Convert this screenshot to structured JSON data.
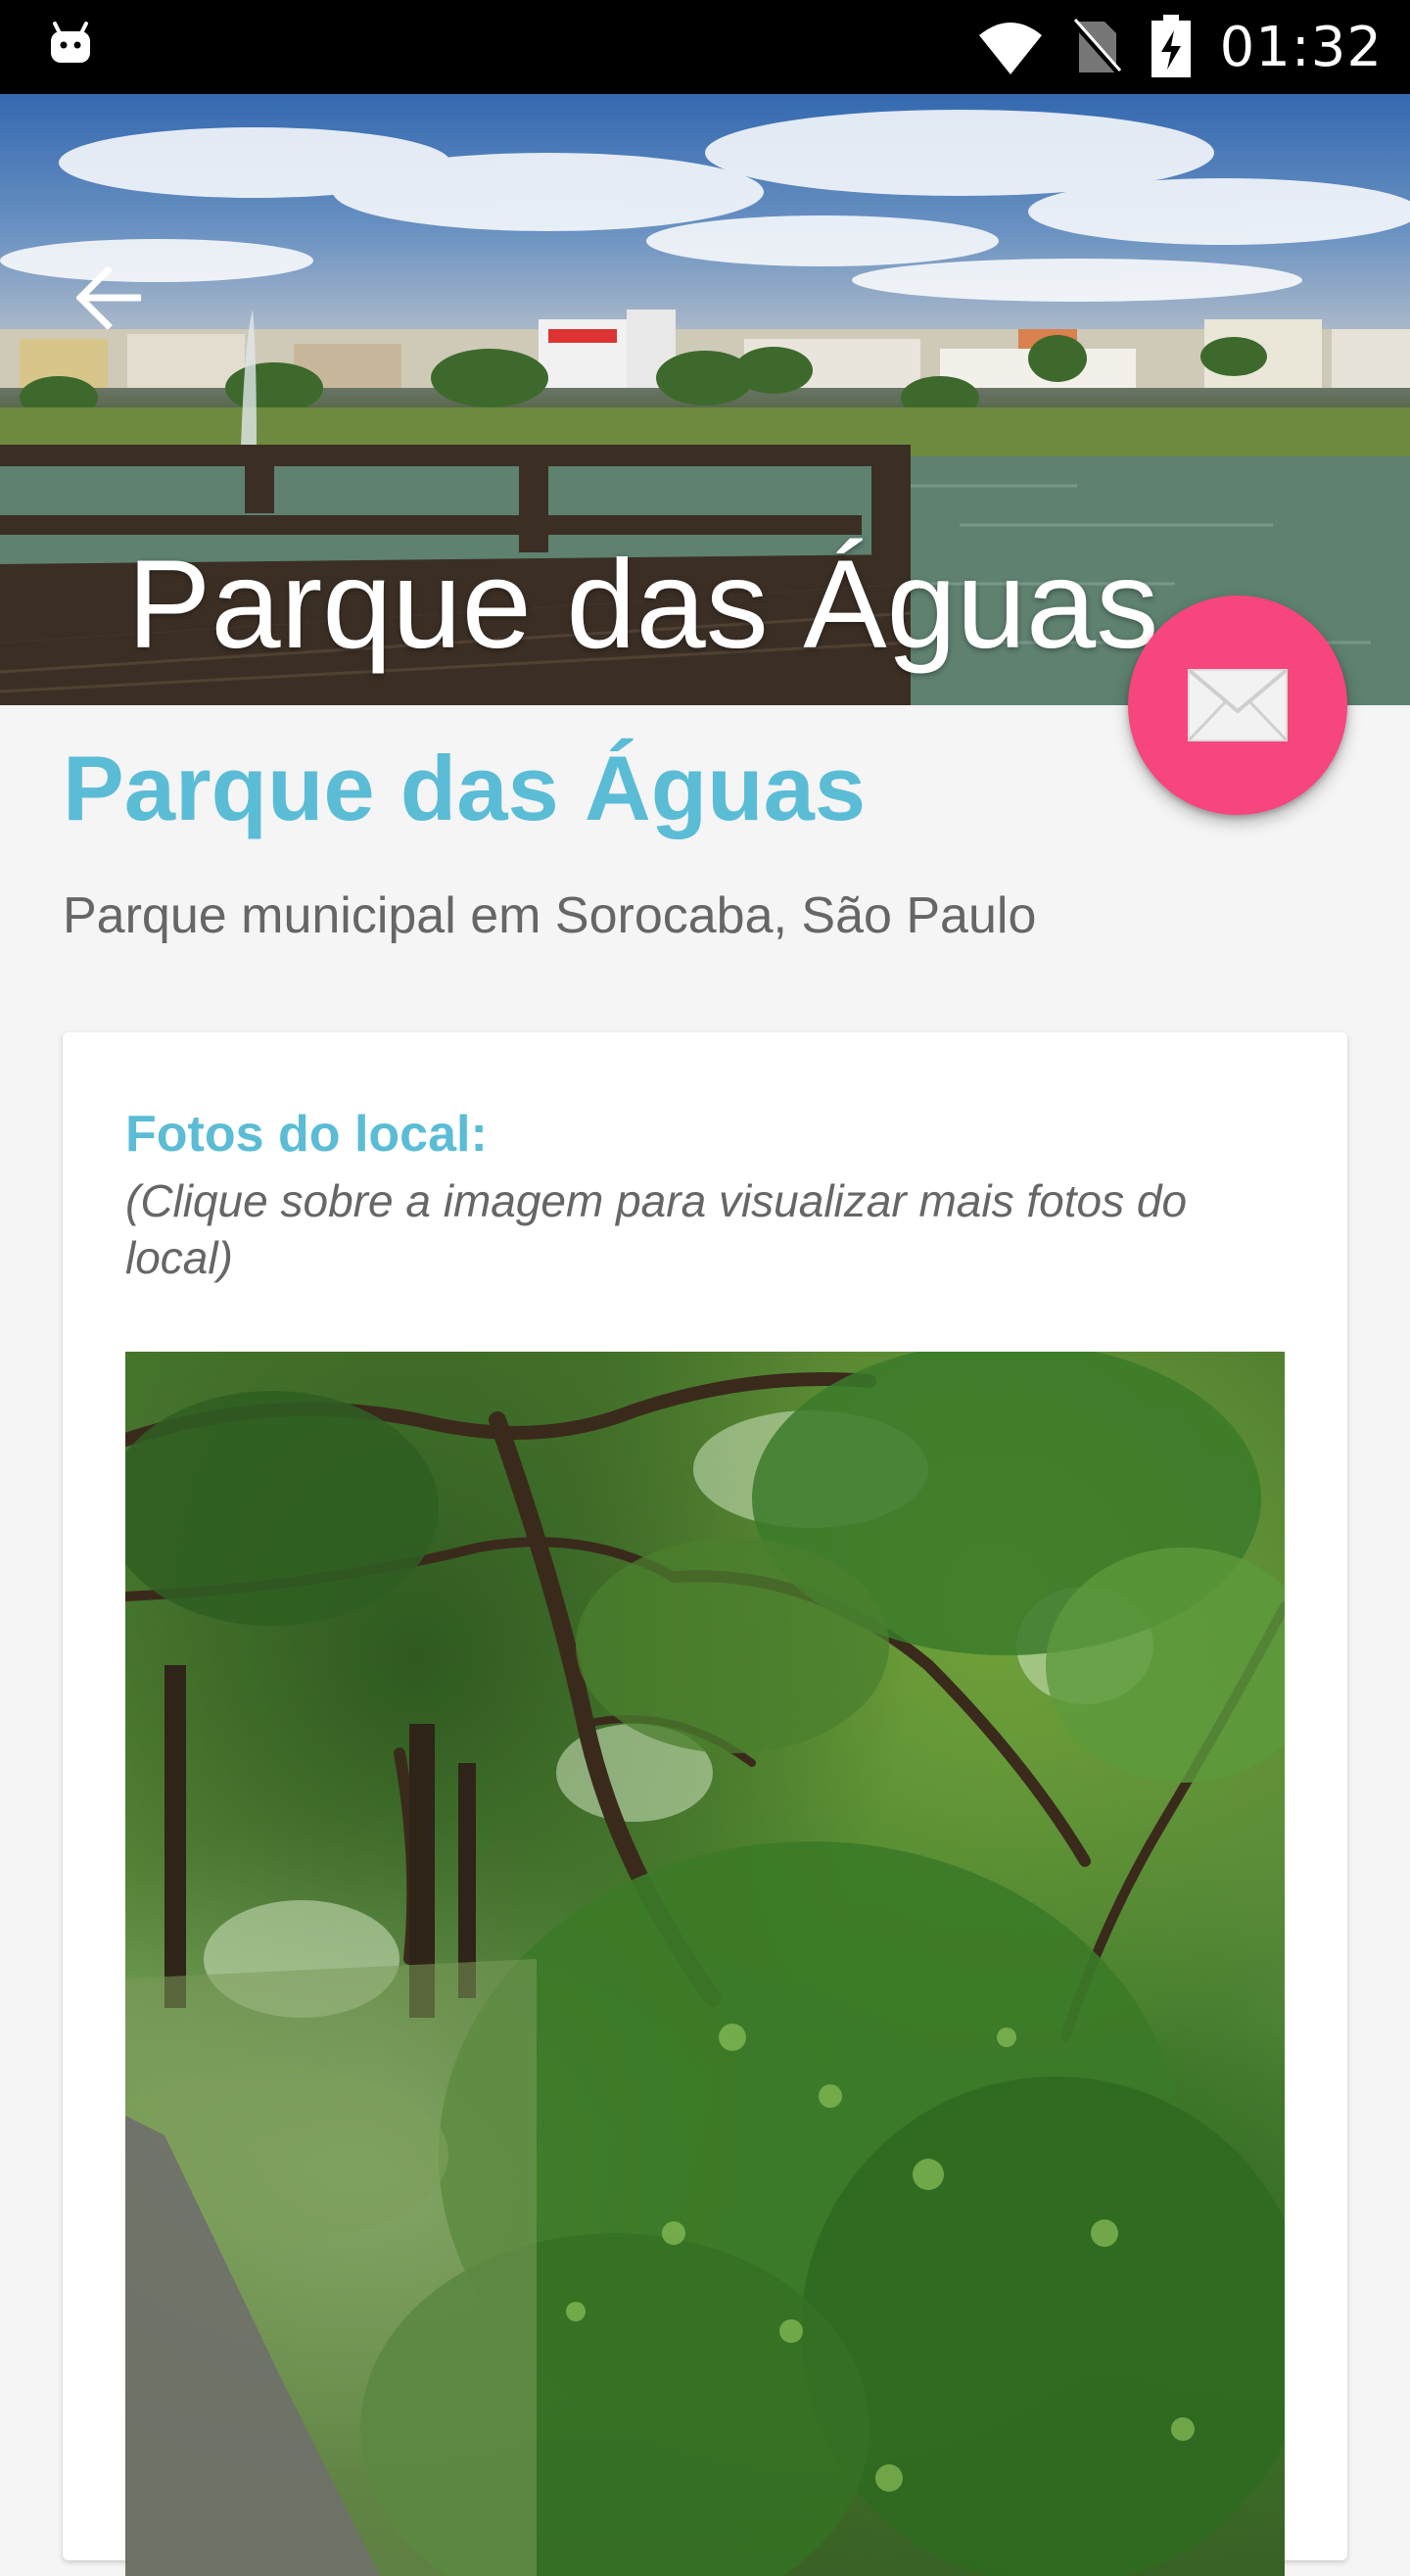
{
  "status_bar": {
    "time": "01:32",
    "icons": [
      "android-icon",
      "wifi-icon",
      "no-sim-icon",
      "battery-charging-icon"
    ]
  },
  "hero": {
    "title": "Parque das Águas",
    "back_icon": "arrow-left-icon"
  },
  "fab": {
    "icon": "mail-icon",
    "color": "#f7457e"
  },
  "place": {
    "title": "Parque das Águas",
    "subtitle": "Parque municipal em Sorocaba, São Paulo",
    "accent_color": "#5bbcd6"
  },
  "photos_card": {
    "heading": "Fotos do local:",
    "hint": "(Clique sobre a imagem para visualizar mais fotos do local)"
  }
}
